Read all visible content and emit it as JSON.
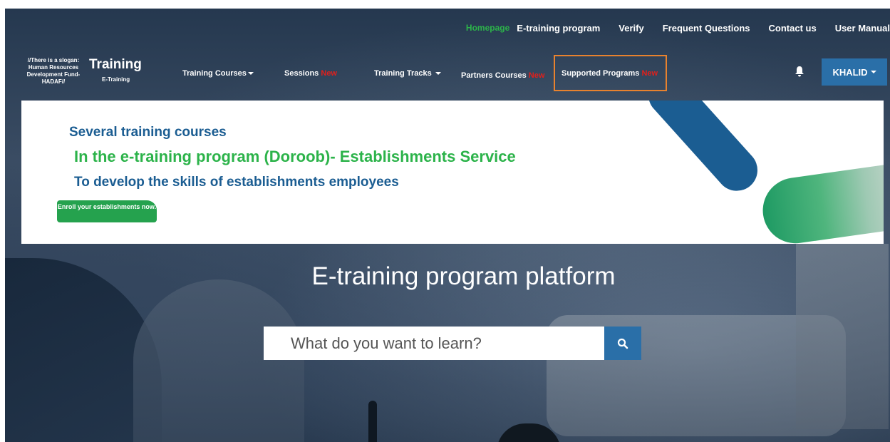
{
  "topnav": {
    "homepage": "Homepage",
    "etraining": "E-training program",
    "verify": "Verify",
    "faq": "Frequent Questions",
    "contact": "Contact us",
    "manual": "User Manual"
  },
  "logo": {
    "slogan": "//There is a slogan: Human Resources Development Fund-HADAF//",
    "title": "Training",
    "subtitle": "E-Training"
  },
  "mainnav": {
    "training_courses": "Training Courses",
    "sessions": "Sessions",
    "training_tracks": "Training Tracks",
    "partners_courses": "Partners Courses",
    "supported_programs": "Supported Programs",
    "new_label": "New"
  },
  "user": {
    "name": "KHALID"
  },
  "banner": {
    "line1": "Several training courses",
    "line2": "In the e-training program (Doroob)- Establishments Service",
    "line3": "To develop the skills of establishments employees",
    "cta": "Enroll your establishments now."
  },
  "hero": {
    "title": "E-training program platform",
    "search_placeholder": "What do you want to learn?"
  },
  "colors": {
    "accent_blue": "#2a6fa8",
    "brand_green": "#2cb34a",
    "new_red": "#e0201c",
    "highlight_orange": "#e8822e"
  },
  "icons": {
    "bell": "bell-icon",
    "search": "search-icon",
    "caret": "caret-down-icon"
  }
}
